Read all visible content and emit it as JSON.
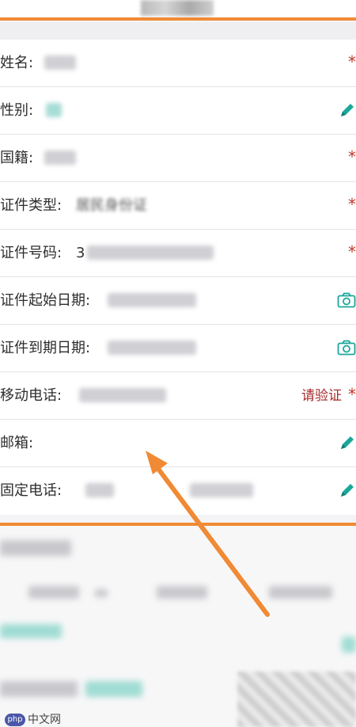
{
  "form": {
    "name_label": "姓名:",
    "gender_label": "性别:",
    "nationality_label": "国籍:",
    "id_type_label": "证件类型:",
    "id_type_value": "居民身份证",
    "id_number_label": "证件号码:",
    "id_number_prefix": "3",
    "id_start_label": "证件起始日期:",
    "id_end_label": "证件到期日期:",
    "mobile_label": "移动电话:",
    "verify_label": "请验证",
    "email_label": "邮箱:",
    "phone_label": "固定电话:",
    "required_mark": "*"
  },
  "colors": {
    "accent_orange": "#f08a34",
    "required_red": "#c0392b",
    "icon_teal": "#1aa89a"
  },
  "icons": [
    "pencil-icon",
    "camera-icon"
  ],
  "watermark": {
    "logo_text": "php",
    "text": "中文网"
  }
}
